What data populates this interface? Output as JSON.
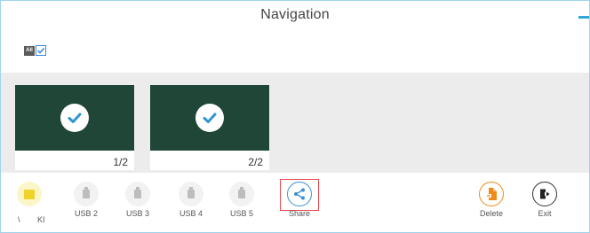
{
  "header": {
    "title": "Navigation"
  },
  "select_all": {
    "badge": "All",
    "checked": true
  },
  "pages": [
    {
      "label": "1/2",
      "selected": true
    },
    {
      "label": "2/2",
      "selected": true
    }
  ],
  "toolbar": {
    "partial_labels": [
      "\\",
      "KI"
    ],
    "items": [
      {
        "label": "USB 2",
        "icon": "usb-drive-icon"
      },
      {
        "label": "USB 3",
        "icon": "usb-drive-icon"
      },
      {
        "label": "USB 4",
        "icon": "usb-drive-icon"
      },
      {
        "label": "USB 5",
        "icon": "usb-drive-icon"
      },
      {
        "label": "Share",
        "icon": "share-icon",
        "highlighted": true
      },
      {
        "label": "Delete",
        "icon": "delete-icon"
      },
      {
        "label": "Exit",
        "icon": "exit-icon"
      }
    ]
  },
  "colors": {
    "thumbnail_bg": "#1f4637",
    "highlight_border": "#e8484f",
    "share_accent": "#3a91cf",
    "delete_accent": "#f08a1c",
    "folder_accent": "#f0d22a"
  }
}
